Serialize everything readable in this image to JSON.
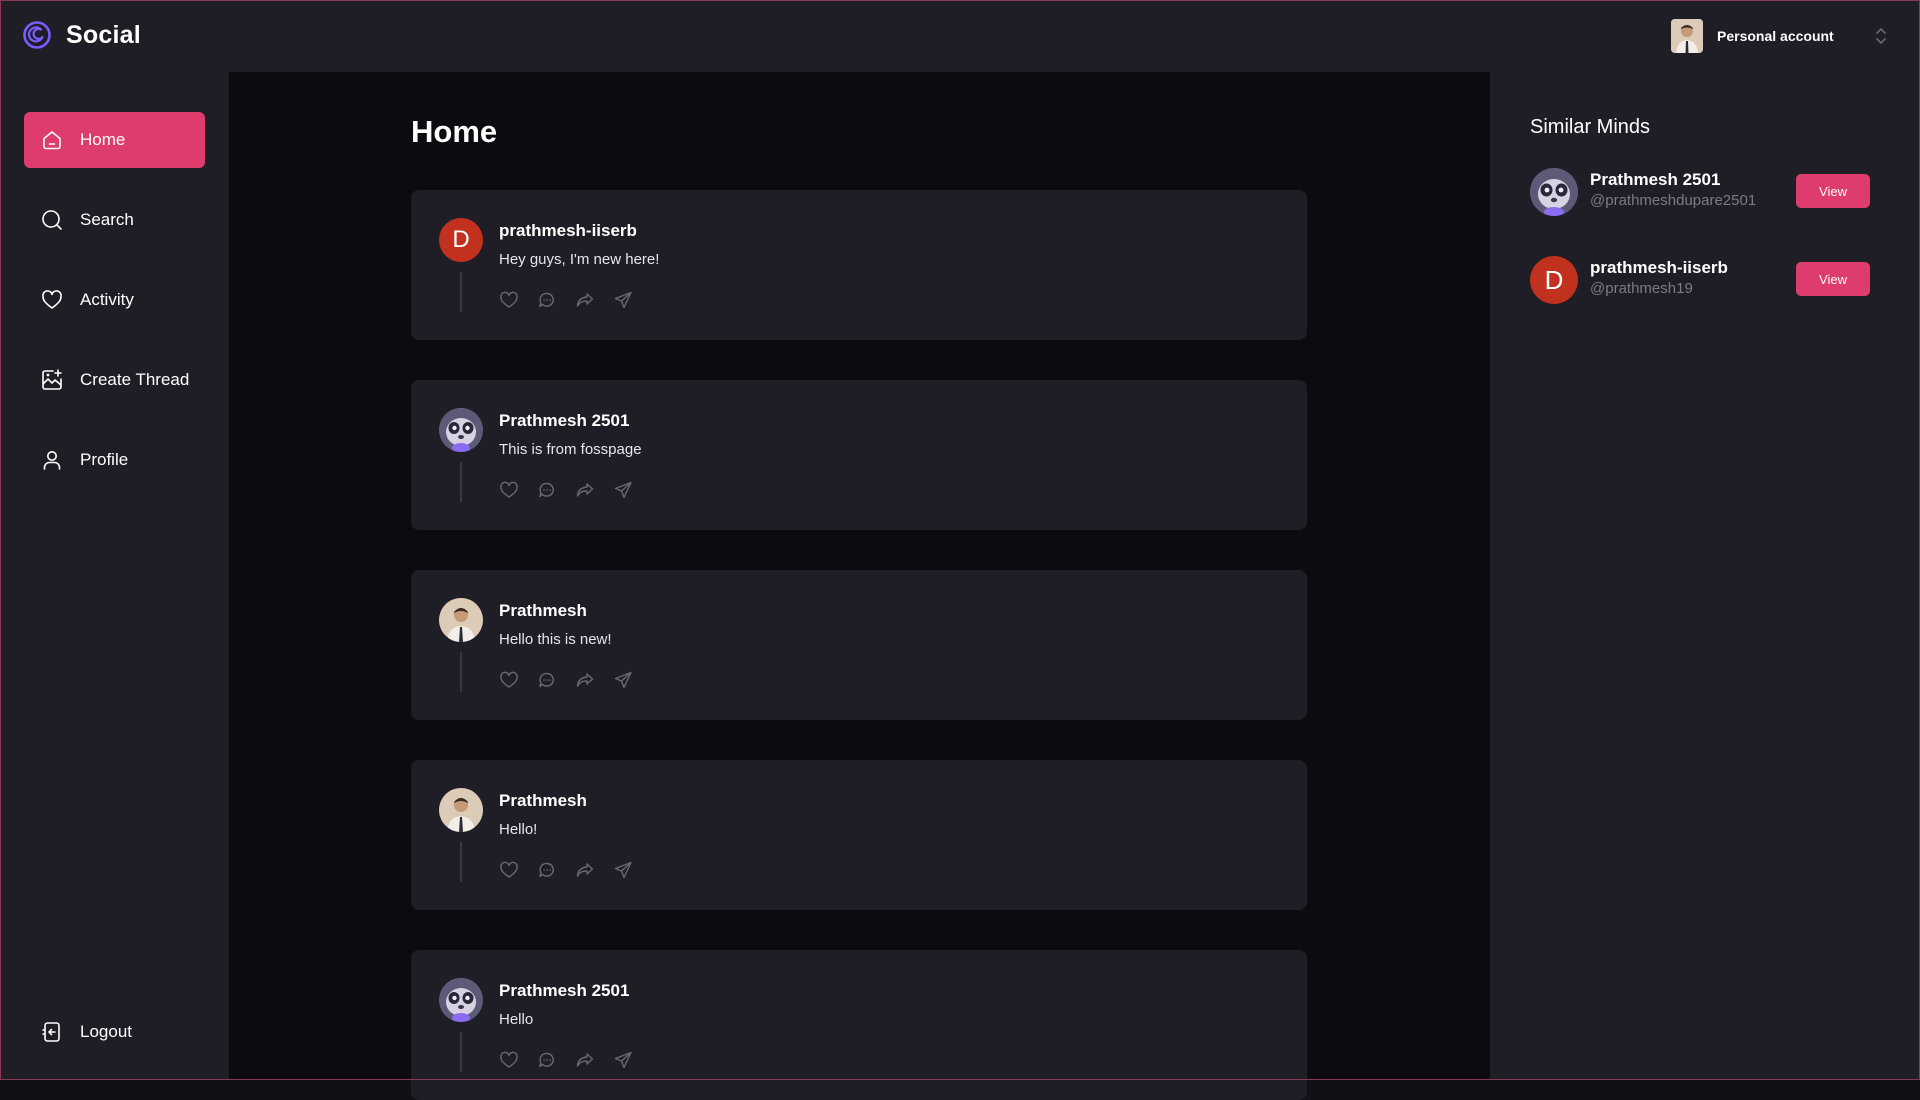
{
  "brand": {
    "name": "Social",
    "accent": "#7c5cff"
  },
  "account": {
    "label": "Personal account"
  },
  "sidebar": {
    "items": [
      {
        "label": "Home",
        "icon": "home-icon",
        "active": true
      },
      {
        "label": "Search",
        "icon": "search-icon",
        "active": false
      },
      {
        "label": "Activity",
        "icon": "heart-icon",
        "active": false
      },
      {
        "label": "Create Thread",
        "icon": "create-thread-icon",
        "active": false
      },
      {
        "label": "Profile",
        "icon": "user-icon",
        "active": false
      }
    ],
    "logout": {
      "label": "Logout",
      "icon": "logout-icon"
    }
  },
  "main": {
    "title": "Home",
    "posts": [
      {
        "author": "prathmesh-iiserb",
        "text": "Hey guys, I'm new here!",
        "avatar": "letter",
        "avatar_letter": "D"
      },
      {
        "author": "Prathmesh 2501",
        "text": "This is from fosspage",
        "avatar": "panda"
      },
      {
        "author": "Prathmesh",
        "text": "Hello this is new!",
        "avatar": "person"
      },
      {
        "author": "Prathmesh",
        "text": "Hello!",
        "avatar": "person"
      },
      {
        "author": "Prathmesh 2501",
        "text": "Hello",
        "avatar": "panda"
      }
    ]
  },
  "right_panel": {
    "title": "Similar Minds",
    "users": [
      {
        "name": "Prathmesh 2501",
        "handle": "@prathmeshdupare2501",
        "button": "View",
        "avatar": "panda"
      },
      {
        "name": "prathmesh-iiserb",
        "handle": "@prathmesh19",
        "button": "View",
        "avatar": "letter",
        "avatar_letter": "D"
      }
    ]
  },
  "colors": {
    "accent_pink": "#dd3c6d",
    "panel_bg": "#1f1d26",
    "feed_bg": "#0e0b10",
    "letter_avatar_bg": "#c2311d"
  }
}
